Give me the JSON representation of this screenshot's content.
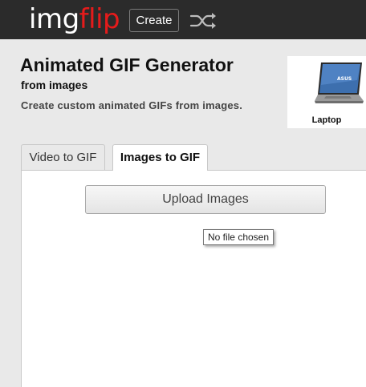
{
  "header": {
    "logo_img": "img",
    "logo_flip": "flip",
    "create_label": "Create",
    "random_icon": "shuffle-icon",
    "logo_accent_color": "#e51b1b"
  },
  "page": {
    "title": "Animated GIF Generator",
    "subtitle": "from images",
    "description": "Create custom animated GIFs from images."
  },
  "ad": {
    "label": "Laptop",
    "icon": "laptop-icon"
  },
  "tabs": [
    {
      "label": "Video to GIF",
      "active": false
    },
    {
      "label": "Images to GIF",
      "active": true
    }
  ],
  "upload": {
    "button_label": "Upload Images",
    "file_status": "No file chosen"
  }
}
